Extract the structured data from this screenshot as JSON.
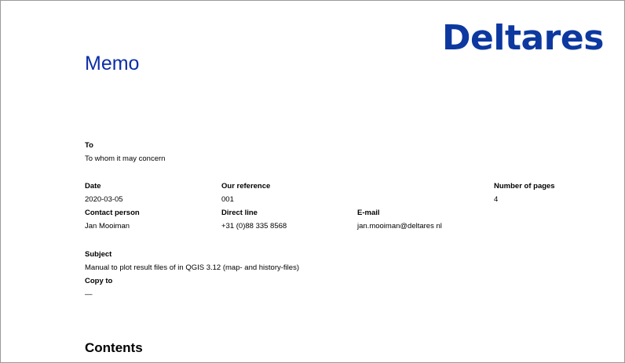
{
  "logo": {
    "text": "Deltares",
    "color": "#0d38a0"
  },
  "memo": {
    "title": "Memo",
    "title_color": "#0d2da8"
  },
  "to": {
    "label": "To",
    "value": "To whom it may concern"
  },
  "date": {
    "label": "Date",
    "value": "2020-03-05"
  },
  "our_reference": {
    "label": "Our reference",
    "value": "001"
  },
  "number_of_pages": {
    "label": "Number of pages",
    "value": "4"
  },
  "contact_person": {
    "label": "Contact person",
    "value": "Jan Mooiman"
  },
  "direct_line": {
    "label": "Direct line",
    "value": "+31 (0)88 335 8568"
  },
  "email": {
    "label": "E-mail",
    "value": "jan.mooiman@deltares nl"
  },
  "subject": {
    "label": "Subject",
    "value": "Manual to plot result files of in QGIS 3.12 (map- and history-files)"
  },
  "copy_to": {
    "label": "Copy to",
    "value": "—"
  },
  "contents": {
    "heading": "Contents"
  }
}
